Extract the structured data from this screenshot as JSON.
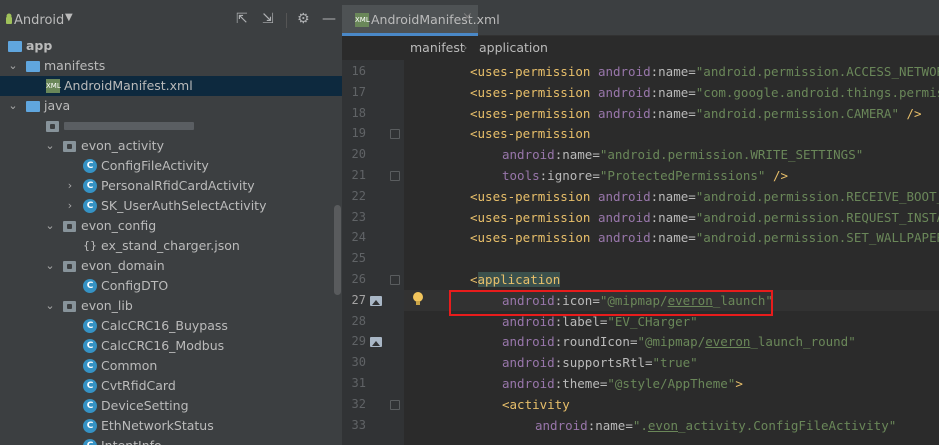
{
  "project_panel": {
    "view_selector": "Android",
    "tree": [
      {
        "id": "app",
        "label": "app",
        "bold": true,
        "indent": 0,
        "icon": "module-folder-icon",
        "arrow": ""
      },
      {
        "id": "manifests",
        "label": "manifests",
        "indent": 1,
        "icon": "folder-icon",
        "arrow": "⌄"
      },
      {
        "id": "androidmanifest",
        "label": "AndroidManifest.xml",
        "indent": 2,
        "icon": "xml-file-icon",
        "arrow": "",
        "selected": true
      },
      {
        "id": "java",
        "label": "java",
        "indent": 1,
        "icon": "folder-icon",
        "arrow": "⌄"
      },
      {
        "id": "package",
        "label": "",
        "indent": 2,
        "icon": "package-icon",
        "arrow": "",
        "blurred": true
      },
      {
        "id": "evon_activity",
        "label": "evon_activity",
        "indent": 3,
        "icon": "package-icon",
        "arrow": "⌄"
      },
      {
        "id": "configfileactivity",
        "label": "ConfigFileActivity",
        "indent": 4,
        "icon": "class-icon",
        "arrow": ""
      },
      {
        "id": "personalrfid",
        "label": "PersonalRfidCardActivity",
        "indent": 4,
        "icon": "class-icon",
        "arrow": "›"
      },
      {
        "id": "sk_userauth",
        "label": "SK_UserAuthSelectActivity",
        "indent": 4,
        "icon": "class-icon",
        "arrow": "›"
      },
      {
        "id": "evon_config",
        "label": "evon_config",
        "indent": 3,
        "icon": "package-icon",
        "arrow": "⌄"
      },
      {
        "id": "ex_stand",
        "label": "ex_stand_charger.json",
        "indent": 4,
        "icon": "json-file-icon",
        "arrow": ""
      },
      {
        "id": "evon_domain",
        "label": "evon_domain",
        "indent": 3,
        "icon": "package-icon",
        "arrow": "⌄"
      },
      {
        "id": "configdto",
        "label": "ConfigDTO",
        "indent": 4,
        "icon": "class-icon",
        "arrow": ""
      },
      {
        "id": "evon_lib",
        "label": "evon_lib",
        "indent": 3,
        "icon": "package-icon",
        "arrow": "⌄"
      },
      {
        "id": "calccrc16_buypass",
        "label": "CalcCRC16_Buypass",
        "indent": 4,
        "icon": "class-icon",
        "arrow": ""
      },
      {
        "id": "calccrc16_modbus",
        "label": "CalcCRC16_Modbus",
        "indent": 4,
        "icon": "class-icon",
        "arrow": ""
      },
      {
        "id": "common",
        "label": "Common",
        "indent": 4,
        "icon": "class-icon",
        "arrow": ""
      },
      {
        "id": "cvtrfidcard",
        "label": "CvtRfidCard",
        "indent": 4,
        "icon": "class-icon",
        "arrow": ""
      },
      {
        "id": "devicesetting",
        "label": "DeviceSetting",
        "indent": 4,
        "icon": "class-icon",
        "arrow": ""
      },
      {
        "id": "ethnetworkstatus",
        "label": "EthNetworkStatus",
        "indent": 4,
        "icon": "class-icon",
        "arrow": ""
      },
      {
        "id": "intentinfo",
        "label": "IntentInfo",
        "indent": 4,
        "icon": "class-icon",
        "arrow": ""
      }
    ]
  },
  "editor": {
    "tab_label": "AndroidManifest.xml",
    "breadcrumb": [
      "manifest",
      "application"
    ],
    "current_line": 27,
    "lines": [
      {
        "n": "16",
        "fold": false,
        "icon": false,
        "indent": 1,
        "tokens": [
          [
            "t",
            "<uses-permission "
          ],
          [
            "ns",
            "android"
          ],
          [
            "a",
            ":name="
          ],
          [
            "v",
            "\"android.permission.ACCESS_NETWORK_STATE\""
          ],
          [
            "t",
            " />"
          ]
        ]
      },
      {
        "n": "17",
        "fold": false,
        "icon": false,
        "indent": 1,
        "tokens": [
          [
            "t",
            "<uses-permission "
          ],
          [
            "ns",
            "android"
          ],
          [
            "a",
            ":name="
          ],
          [
            "v",
            "\"com.google.android.things.permission.MANAGE_INPUT_DRIVERS\""
          ],
          [
            "t",
            " />"
          ]
        ]
      },
      {
        "n": "18",
        "fold": false,
        "icon": false,
        "indent": 1,
        "tokens": [
          [
            "t",
            "<uses-permission "
          ],
          [
            "ns",
            "android"
          ],
          [
            "a",
            ":name="
          ],
          [
            "v",
            "\"android.permission.CAMERA\""
          ],
          [
            "t",
            " />"
          ]
        ]
      },
      {
        "n": "19",
        "fold": true,
        "icon": false,
        "indent": 1,
        "tokens": [
          [
            "t",
            "<uses-permission"
          ]
        ]
      },
      {
        "n": "20",
        "fold": false,
        "icon": false,
        "indent": 2,
        "tokens": [
          [
            "ns",
            "android"
          ],
          [
            "a",
            ":name="
          ],
          [
            "v",
            "\"android.permission.WRITE_SETTINGS\""
          ]
        ]
      },
      {
        "n": "21",
        "fold": true,
        "icon": false,
        "indent": 2,
        "tokens": [
          [
            "ns",
            "tools"
          ],
          [
            "a",
            ":ignore="
          ],
          [
            "v",
            "\"ProtectedPermissions\""
          ],
          [
            "t",
            " />"
          ]
        ]
      },
      {
        "n": "22",
        "fold": false,
        "icon": false,
        "indent": 1,
        "tokens": [
          [
            "t",
            "<uses-permission "
          ],
          [
            "ns",
            "android"
          ],
          [
            "a",
            ":name="
          ],
          [
            "v",
            "\"android.permission.RECEIVE_BOOT_COMPLETED\""
          ],
          [
            "t",
            " />"
          ]
        ]
      },
      {
        "n": "23",
        "fold": false,
        "icon": false,
        "indent": 1,
        "tokens": [
          [
            "t",
            "<uses-permission "
          ],
          [
            "ns",
            "android"
          ],
          [
            "a",
            ":name="
          ],
          [
            "v",
            "\"android.permission.REQUEST_INSTALL_PACKAGES\""
          ],
          [
            "t",
            " />"
          ]
        ]
      },
      {
        "n": "24",
        "fold": false,
        "icon": false,
        "indent": 1,
        "tokens": [
          [
            "t",
            "<uses-permission "
          ],
          [
            "ns",
            "android"
          ],
          [
            "a",
            ":name="
          ],
          [
            "v",
            "\"android.permission.SET_WALLPAPER\""
          ],
          [
            "t",
            " />"
          ]
        ]
      },
      {
        "n": "25",
        "fold": false,
        "icon": false,
        "indent": 0,
        "tokens": []
      },
      {
        "n": "26",
        "fold": true,
        "icon": false,
        "indent": 1,
        "tokens": [
          [
            "t",
            "<"
          ],
          [
            "thl",
            "application"
          ]
        ]
      },
      {
        "n": "27",
        "fold": false,
        "icon": true,
        "indent": 2,
        "current": true,
        "tokens": [
          [
            "ns",
            "android"
          ],
          [
            "a",
            ":icon="
          ],
          [
            "v",
            "\"@mipmap/"
          ],
          [
            "vu",
            "everon"
          ],
          [
            "v",
            "_launch\""
          ]
        ]
      },
      {
        "n": "28",
        "fold": false,
        "icon": false,
        "indent": 2,
        "tokens": [
          [
            "ns",
            "android"
          ],
          [
            "a",
            ":label="
          ],
          [
            "v",
            "\"EV_CHarger\""
          ]
        ]
      },
      {
        "n": "29",
        "fold": false,
        "icon": true,
        "indent": 2,
        "tokens": [
          [
            "ns",
            "android"
          ],
          [
            "a",
            ":roundIcon="
          ],
          [
            "v",
            "\"@mipmap/"
          ],
          [
            "vu",
            "everon"
          ],
          [
            "v",
            "_launch_round\""
          ]
        ]
      },
      {
        "n": "30",
        "fold": false,
        "icon": false,
        "indent": 2,
        "tokens": [
          [
            "ns",
            "android"
          ],
          [
            "a",
            ":supportsRtl="
          ],
          [
            "v",
            "\"true\""
          ]
        ]
      },
      {
        "n": "31",
        "fold": false,
        "icon": false,
        "indent": 2,
        "tokens": [
          [
            "ns",
            "android"
          ],
          [
            "a",
            ":theme="
          ],
          [
            "v",
            "\"@style/AppTheme\""
          ],
          [
            "t",
            ">"
          ]
        ]
      },
      {
        "n": "32",
        "fold": true,
        "icon": false,
        "indent": 2,
        "tokens": [
          [
            "t",
            "<activity"
          ]
        ]
      },
      {
        "n": "33",
        "fold": false,
        "icon": false,
        "indent": 3,
        "tokens": [
          [
            "ns",
            "android"
          ],
          [
            "a",
            ":name="
          ],
          [
            "v",
            "\"."
          ],
          [
            "vu",
            "evon"
          ],
          [
            "v",
            "_activity.ConfigFileActivity\""
          ]
        ]
      }
    ]
  }
}
